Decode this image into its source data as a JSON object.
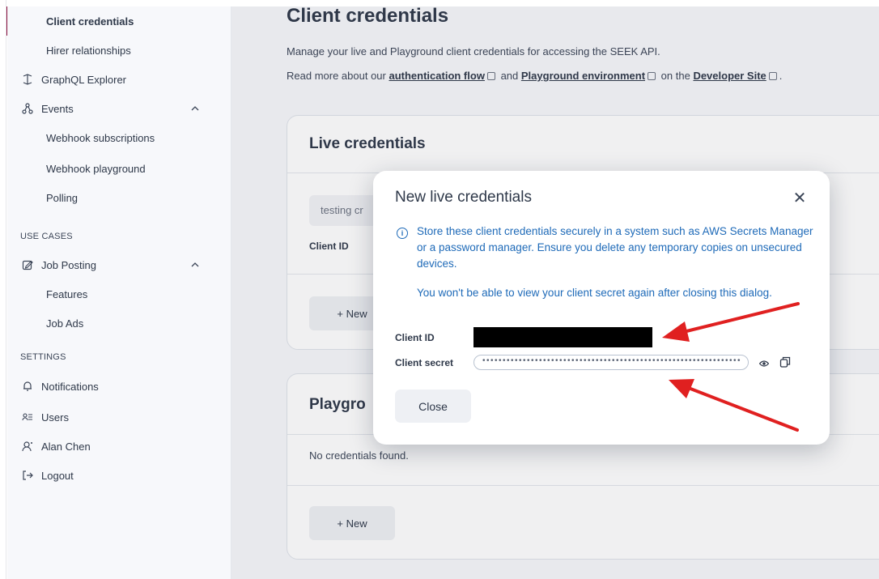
{
  "sidebar": {
    "items": [
      {
        "label": "Client credentials",
        "icon": "",
        "active": true
      },
      {
        "label": "Hirer relationships",
        "icon": ""
      },
      {
        "label": "GraphQL Explorer",
        "icon": "graphql-icon"
      },
      {
        "label": "Events",
        "icon": "events-icon"
      },
      {
        "label": "Webhook subscriptions",
        "icon": ""
      },
      {
        "label": "Webhook playground",
        "icon": ""
      },
      {
        "label": "Polling",
        "icon": ""
      },
      {
        "label": "Job Posting",
        "icon": "job-posting-icon"
      },
      {
        "label": "Features",
        "icon": ""
      },
      {
        "label": "Job Ads",
        "icon": ""
      },
      {
        "label": "Notifications",
        "icon": "bell-icon"
      },
      {
        "label": "Users",
        "icon": "users-icon"
      },
      {
        "label": "Alan Chen",
        "icon": "user-icon"
      },
      {
        "label": "Logout",
        "icon": "logout-icon"
      }
    ],
    "sections": {
      "use_cases": "USE CASES",
      "settings": "SETTINGS"
    }
  },
  "main": {
    "title": "Client credentials",
    "intro": "Manage your live and Playground client credentials for accessing the SEEK API.",
    "read_more_prefix": "Read more about our",
    "link_auth": "authentication flow",
    "link_and": "and",
    "link_playground": "Playground environment",
    "link_on_the": "on the",
    "link_devsite": "Developer Site",
    "period": "."
  },
  "live_card": {
    "title": "Live credentials",
    "input_value": "testing cr",
    "client_id_label": "Client ID",
    "new_button": "+ New"
  },
  "playground_card": {
    "title": "Playgro",
    "empty_text": "No credentials found.",
    "new_button": "+ New"
  },
  "modal": {
    "title": "New live credentials",
    "close_glyph": "✕",
    "info_glyph": "i",
    "info_text": "Store these client credentials securely in a system such as AWS Secrets Manager or a password manager. Ensure you delete any temporary copies on unsecured devices.",
    "warning_text": "You won't be able to view your client secret again after closing this dialog.",
    "client_id_label": "Client ID",
    "client_secret_label": "Client secret",
    "client_secret_value": "••••••••••••••••••••••••••••••••••••••••••••••••••••••••••••••••",
    "close_button": "Close"
  },
  "colors": {
    "accent": "#8a0f3d",
    "info_blue": "#1e6ab8",
    "annotation_red": "#e02020"
  }
}
